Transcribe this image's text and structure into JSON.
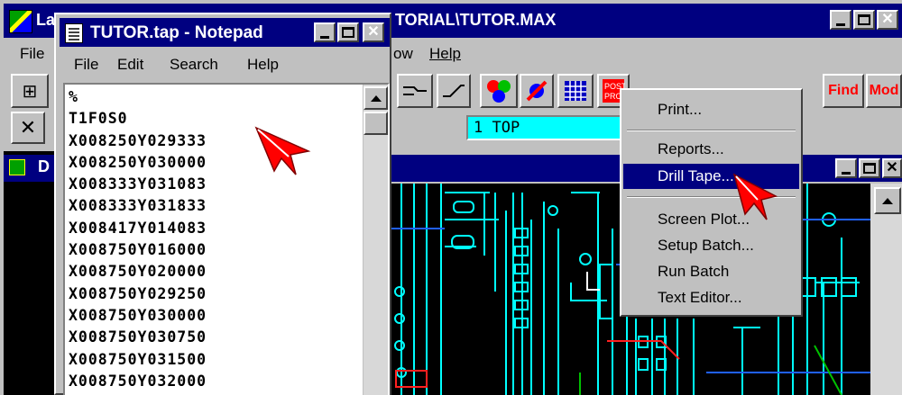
{
  "app": {
    "title_left": "La",
    "title_right": "TORIAL\\TUTOR.MAX",
    "menu": {
      "file": "File",
      "window_fragment": "ow",
      "help": "Help"
    },
    "toolbar": {
      "find": "Find",
      "mod": "Mod"
    },
    "layer_field": "1 TOP"
  },
  "left_window": {
    "title_fragment": "D"
  },
  "notepad": {
    "title": "TUTOR.tap - Notepad",
    "menu": {
      "file": "File",
      "edit": "Edit",
      "search": "Search",
      "help": "Help"
    },
    "lines": [
      "%",
      "T1F0S0",
      "X008250Y029333",
      "X008250Y030000",
      "X008333Y031083",
      "X008333Y031833",
      "X008417Y014083",
      "X008750Y016000",
      "X008750Y020000",
      "X008750Y029250",
      "X008750Y030000",
      "X008750Y030750",
      "X008750Y031500",
      "X008750Y032000"
    ]
  },
  "context_menu": {
    "items": [
      {
        "label": "Print...",
        "selected": false
      },
      {
        "label": "Reports...",
        "selected": false
      },
      {
        "label": "Drill Tape...",
        "selected": true
      },
      {
        "label": "Screen Plot...",
        "selected": false
      },
      {
        "label": "Setup Batch...",
        "selected": false
      },
      {
        "label": "Run Batch",
        "selected": false
      },
      {
        "label": "Text Editor...",
        "selected": false
      }
    ]
  },
  "colors": {
    "title_bar": "#000080",
    "pcb_trace": "#00ffff",
    "pcb_background": "#000000",
    "layer_field_bg": "#00ffff",
    "pointer": "#ff0000"
  },
  "icons": {
    "minimize": "minimize-icon",
    "maximize": "maximize-icon",
    "close": "close-icon"
  }
}
